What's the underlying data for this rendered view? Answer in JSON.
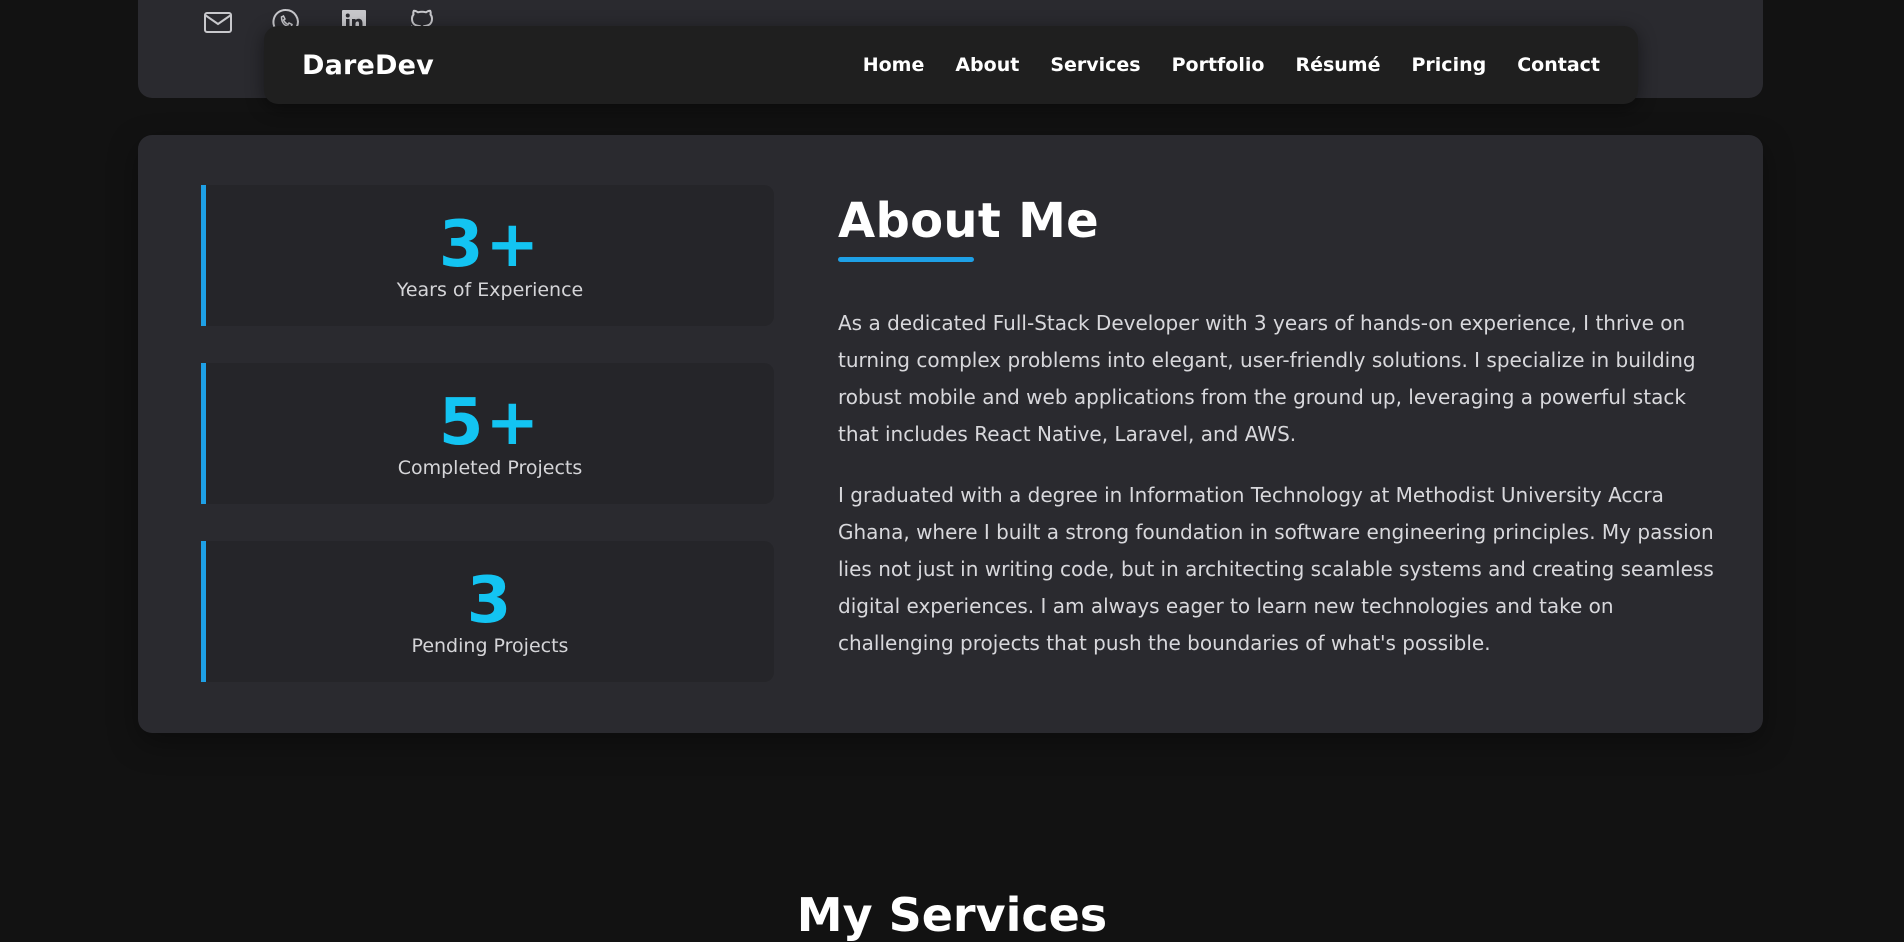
{
  "social": {
    "icons": [
      "mail-icon",
      "whatsapp-icon",
      "linkedin-icon",
      "github-icon"
    ]
  },
  "nav": {
    "brand": "DareDev",
    "links": [
      "Home",
      "About",
      "Services",
      "Portfolio",
      "Résumé",
      "Pricing",
      "Contact"
    ]
  },
  "stats": [
    {
      "value": "3+",
      "label": "Years of Experience"
    },
    {
      "value": "5+",
      "label": "Completed Projects"
    },
    {
      "value": "3",
      "label": "Pending Projects"
    }
  ],
  "about": {
    "title": "About Me",
    "paragraphs": [
      "As a dedicated Full-Stack Developer with 3 years of hands-on experience, I thrive on turning complex problems into elegant, user-friendly solutions. I specialize in building robust mobile and web applications from the ground up, leveraging a powerful stack that includes React Native, Laravel, and AWS.",
      "I graduated with a degree in Information Technology at Methodist University Accra Ghana, where I built a strong foundation in software engineering principles. My passion lies not just in writing code, but in architecting scalable systems and creating seamless digital experiences. I am always eager to learn new technologies and take on challenging projects that push the boundaries of what's possible."
    ]
  },
  "next_section": {
    "title": "My Services"
  },
  "colors": {
    "accent": "#13c4f2",
    "accent_bar": "#1ea0e6",
    "page_bg": "#121212",
    "card_bg": "#2a2a2f"
  }
}
